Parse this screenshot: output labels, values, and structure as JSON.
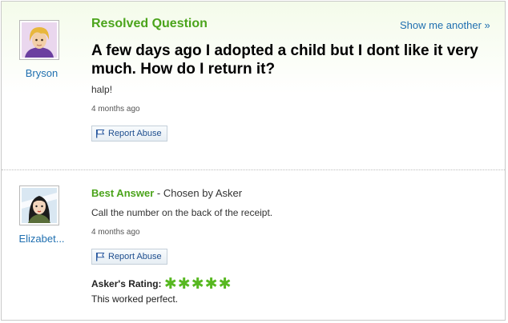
{
  "question": {
    "section_title": "Resolved Question",
    "show_another_label": "Show me another »",
    "asker_name": "Bryson",
    "text": "A few days ago I adopted a child but I dont like it very much. How do I return it?",
    "details": "halp!",
    "timestamp": "4 months ago",
    "report_label": "Report Abuse"
  },
  "best_answer": {
    "title": "Best Answer",
    "chosen_by": " - Chosen by Asker",
    "answerer_name": "Elizabet...",
    "text": "Call the number on the back of the receipt.",
    "timestamp": "4 months ago",
    "report_label": "Report Abuse",
    "rating_label": "Asker's Rating:",
    "rating_stars": "✱✱✱✱✱",
    "rating_value": 5,
    "rating_comment": "This worked perfect."
  },
  "colors": {
    "accent_green": "#4ba41b",
    "link_blue": "#1f6fb0"
  }
}
